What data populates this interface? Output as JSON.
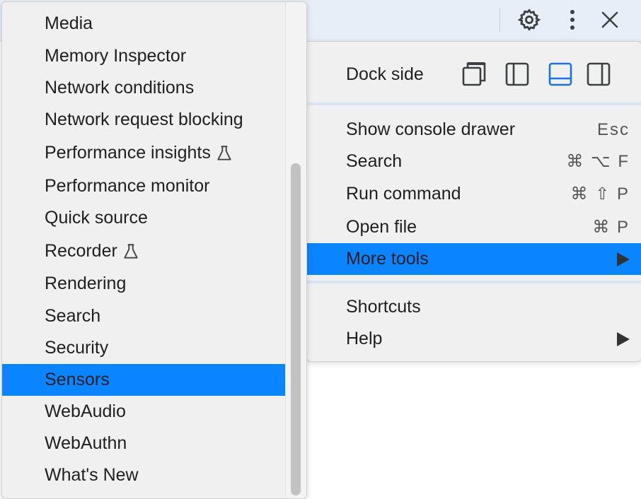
{
  "more_tools_submenu": {
    "items": [
      {
        "label": "Media",
        "experimental": false
      },
      {
        "label": "Memory Inspector",
        "experimental": false
      },
      {
        "label": "Network conditions",
        "experimental": false
      },
      {
        "label": "Network request blocking",
        "experimental": false
      },
      {
        "label": "Performance insights",
        "experimental": true
      },
      {
        "label": "Performance monitor",
        "experimental": false
      },
      {
        "label": "Quick source",
        "experimental": false
      },
      {
        "label": "Recorder",
        "experimental": true
      },
      {
        "label": "Rendering",
        "experimental": false
      },
      {
        "label": "Search",
        "experimental": false
      },
      {
        "label": "Security",
        "experimental": false
      },
      {
        "label": "Sensors",
        "experimental": false,
        "selected": true
      },
      {
        "label": "WebAudio",
        "experimental": false
      },
      {
        "label": "WebAuthn",
        "experimental": false
      },
      {
        "label": "What's New",
        "experimental": false
      }
    ]
  },
  "main_menu": {
    "dock_side_label": "Dock side",
    "dock_options": [
      "undock-icon",
      "dock-left-icon",
      "dock-bottom-icon",
      "dock-right-icon"
    ],
    "dock_selected": "dock-bottom-icon",
    "items": [
      {
        "label": "Show console drawer",
        "shortcut": "Esc"
      },
      {
        "label": "Search",
        "shortcut": "⌘ ⌥ F"
      },
      {
        "label": "Run command",
        "shortcut": "⌘ ⇧ P"
      },
      {
        "label": "Open file",
        "shortcut": "⌘ P"
      },
      {
        "label": "More tools",
        "submenu": true,
        "selected": true
      },
      {
        "label": "Shortcuts"
      },
      {
        "label": "Help",
        "submenu": true
      }
    ]
  },
  "toolbar": {
    "icons": [
      "settings-gear-icon",
      "more-options-icon",
      "close-icon"
    ]
  },
  "colors": {
    "selection": "#0a84ff",
    "menu_background": "#f0f0f0",
    "toolbar_background": "#e8eef7",
    "active_dock": "#1a73e8"
  }
}
